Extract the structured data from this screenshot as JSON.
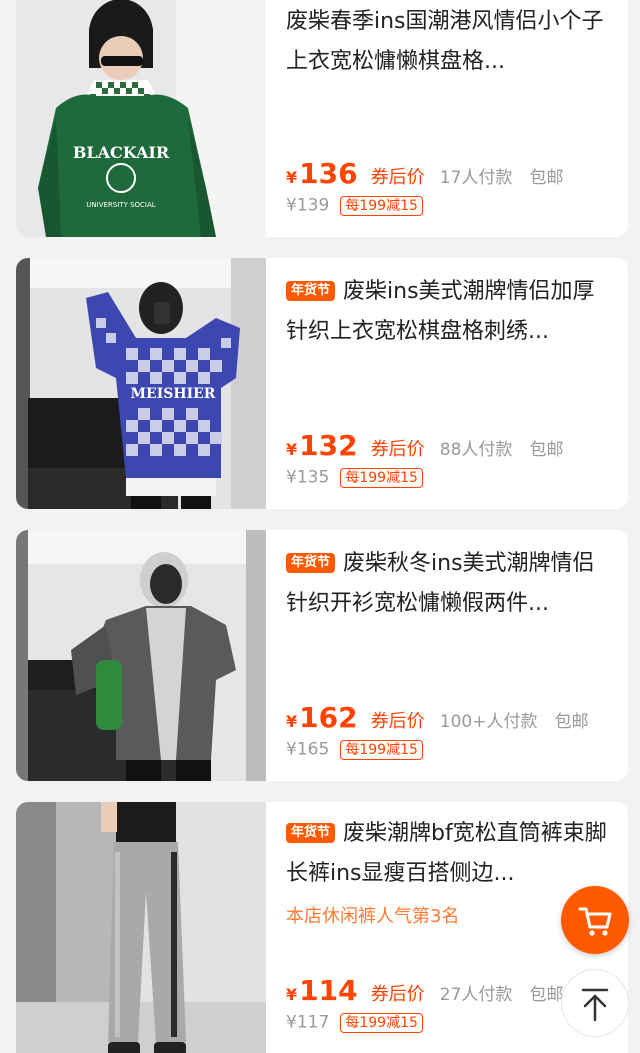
{
  "products": [
    {
      "badge": "",
      "title": "废柴春季ins国潮港风情侣小个子上衣宽松慵懒棋盘格...",
      "rank": "",
      "currency": "¥",
      "price": "136",
      "coupon_label": "券后价",
      "paid": "17人付款",
      "shipping": "包邮",
      "orig_price": "¥139",
      "promo": "每199减15",
      "image": "green-checker-collar-sweatshirt"
    },
    {
      "badge": "年货节",
      "title": "废柴ins美式潮牌情侣加厚针织上衣宽松棋盘格刺绣...",
      "rank": "",
      "currency": "¥",
      "price": "132",
      "coupon_label": "券后价",
      "paid": "88人付款",
      "shipping": "包邮",
      "orig_price": "¥135",
      "promo": "每199减15",
      "image": "blue-checker-knit-sweater"
    },
    {
      "badge": "年货节",
      "title": "废柴秋冬ins美式潮牌情侣针织开衫宽松慵懒假两件...",
      "rank": "",
      "currency": "¥",
      "price": "162",
      "coupon_label": "券后价",
      "paid": "100+人付款",
      "shipping": "包邮",
      "orig_price": "¥165",
      "promo": "每199减15",
      "image": "grey-knit-cardigan-hoodie"
    },
    {
      "badge": "年货节",
      "title": "废柴潮牌bf宽松直筒裤束脚长裤ins显瘦百搭侧边...",
      "rank": "本店休闲裤人气第3名",
      "currency": "¥",
      "price": "114",
      "coupon_label": "券后价",
      "paid": "27人付款",
      "shipping": "包邮",
      "orig_price": "¥117",
      "promo": "每199减15",
      "image": "grey-striped-jogger-pants"
    }
  ],
  "floating": {
    "cart_icon": "shopping-cart-icon",
    "top_icon": "arrow-up-icon"
  },
  "colors": {
    "accent": "#ff4400",
    "badge": "#ff5a00",
    "muted": "#999999"
  }
}
